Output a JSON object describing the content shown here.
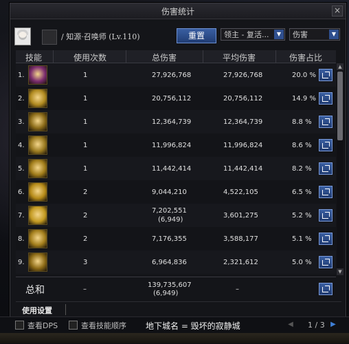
{
  "window": {
    "title": "伤害统计",
    "close_label": "×"
  },
  "player": {
    "name": "/ 知源·召唤师 (Lv.110)"
  },
  "controls": {
    "reset_label": "重置",
    "filter_target": "领主 - 复活...",
    "filter_type": "伤害"
  },
  "table": {
    "columns": [
      "技能",
      "使用次数",
      "总伤害",
      "平均伤害",
      "伤害占比"
    ],
    "rows": [
      {
        "rank": "1.",
        "uses": "1",
        "total": "27,926,768",
        "total_sub": "",
        "avg": "27,926,768",
        "pct": "20.0 %",
        "icon_color": "#7a2c6e",
        "icon": "skill-1-icon"
      },
      {
        "rank": "2.",
        "uses": "1",
        "total": "20,756,112",
        "total_sub": "",
        "avg": "20,756,112",
        "pct": "14.9 %",
        "icon_color": "#b08a20",
        "icon": "skill-2-icon"
      },
      {
        "rank": "3.",
        "uses": "1",
        "total": "12,364,739",
        "total_sub": "",
        "avg": "12,364,739",
        "pct": "8.8 %",
        "icon_color": "#8a6a18",
        "icon": "skill-3-icon"
      },
      {
        "rank": "4.",
        "uses": "1",
        "total": "11,996,824",
        "total_sub": "",
        "avg": "11,996,824",
        "pct": "8.6 %",
        "icon_color": "#9a7a20",
        "icon": "skill-4-icon"
      },
      {
        "rank": "5.",
        "uses": "1",
        "total": "11,442,414",
        "total_sub": "",
        "avg": "11,442,414",
        "pct": "8.2 %",
        "icon_color": "#a07c1a",
        "icon": "skill-5-icon"
      },
      {
        "rank": "6.",
        "uses": "2",
        "total": "9,044,210",
        "total_sub": "",
        "avg": "4,522,105",
        "pct": "6.5 %",
        "icon_color": "#b58a18",
        "icon": "skill-6-icon"
      },
      {
        "rank": "7.",
        "uses": "2",
        "total": "7,202,551",
        "total_sub": "(6,949)",
        "avg": "3,601,275",
        "pct": "5.2 %",
        "icon_color": "#c39a22",
        "icon": "skill-7-icon"
      },
      {
        "rank": "8.",
        "uses": "2",
        "total": "7,176,355",
        "total_sub": "",
        "avg": "3,588,177",
        "pct": "5.1 %",
        "icon_color": "#a37e1c",
        "icon": "skill-8-icon"
      },
      {
        "rank": "9.",
        "uses": "3",
        "total": "6,964,836",
        "total_sub": "",
        "avg": "2,321,612",
        "pct": "5.0 %",
        "icon_color": "#8c6a16",
        "icon": "skill-9-icon"
      }
    ]
  },
  "total": {
    "label": "总和",
    "uses": "–",
    "total": "139,735,607",
    "total_sub": "(6,949)",
    "avg": "–"
  },
  "settings": {
    "label": "使用设置"
  },
  "bottom": {
    "show_dps": "查看DPS",
    "show_order": "查看技能顺序",
    "dungeon": "地下城名 = 毁坏的寂静城",
    "page": "1 / 3"
  }
}
